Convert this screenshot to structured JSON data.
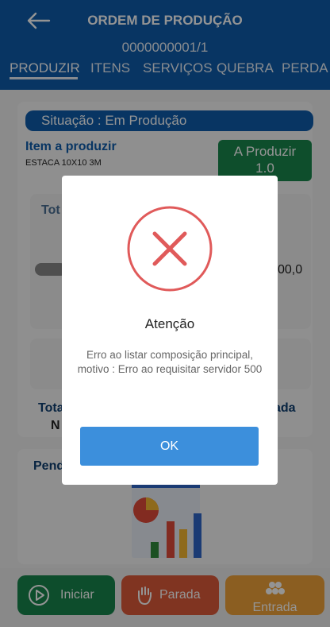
{
  "header": {
    "title": "ORDEM DE PRODUÇÃO",
    "order_number": "0000000001/1",
    "tabs": [
      {
        "label": "PRODUZIR",
        "active": true
      },
      {
        "label": "ITENS",
        "active": false
      },
      {
        "label": "SERVIÇOS",
        "active": false
      },
      {
        "label": "QUEBRA",
        "active": false
      },
      {
        "label": "PERDA",
        "active": false
      }
    ]
  },
  "content": {
    "situacao": "Situação : Em Produção",
    "item_label": "Item a produzir",
    "item_name": "ESTACA 10X10 3M",
    "a_produzir_label": "A Produzir",
    "a_produzir_value": "1.0",
    "partial_tot": "Tot",
    "partial_value": "00,0",
    "partial_total": "Tota",
    "partial_n": "N",
    "partial_ada": "ada",
    "partial_pend": "Pend"
  },
  "buttons": {
    "iniciar": "Iniciar",
    "parada": "Parada",
    "entrada": "Entrada"
  },
  "dialog": {
    "title": "Atenção",
    "message": "Erro ao listar composição principal, motivo : Erro ao requisitar servidor 500",
    "ok_label": "OK"
  },
  "colors": {
    "primary": "#0e5cab",
    "green": "#18854c",
    "red": "#dd5a3a",
    "orange": "#f0a23a",
    "error": "#e05a5a",
    "ok": "#3c8fdc"
  }
}
